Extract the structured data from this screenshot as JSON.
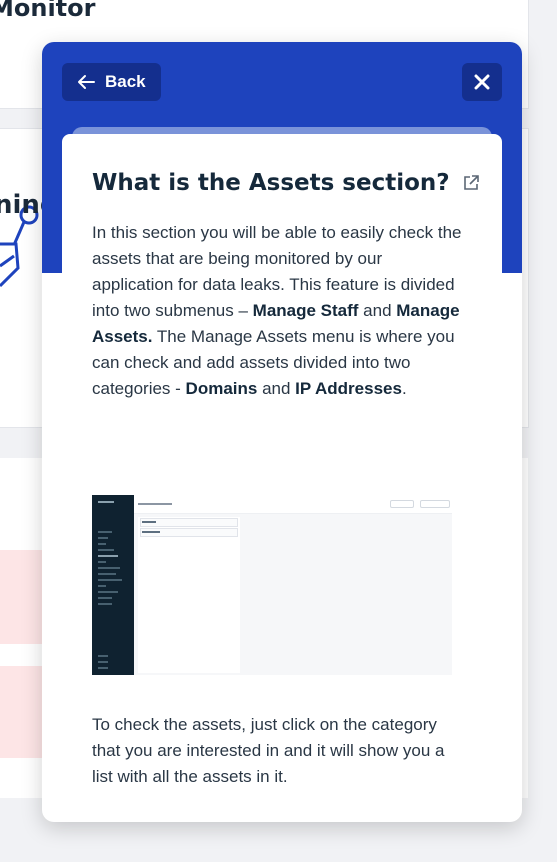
{
  "background": {
    "page_title": "Monitor",
    "card_text": "ning"
  },
  "modal": {
    "back_label": "Back",
    "article": {
      "title": "What is the Assets section?",
      "intro": {
        "t1": "In this section you will be able to easily check the assets that are being monitored by our application for data leaks. This feature is divided into two submenus – ",
        "b1": "Manage Staff",
        "t2": " and ",
        "b2": "Manage Assets.",
        "t3": " The Manage Assets menu is where you can check and add assets divided into two categories - ",
        "b3": "Domains",
        "t4": " and ",
        "b4": "IP Addresses",
        "t5": "."
      },
      "outro": "To check the assets, just click on the category that you are interested in and it will show you a list with all the assets in it."
    }
  },
  "colors": {
    "modal_header": "#1e43bd",
    "button_bg": "#142f8e",
    "pink": "#fde5e6"
  },
  "icons": [
    "arrow-left-icon",
    "close-icon",
    "external-link-icon"
  ]
}
